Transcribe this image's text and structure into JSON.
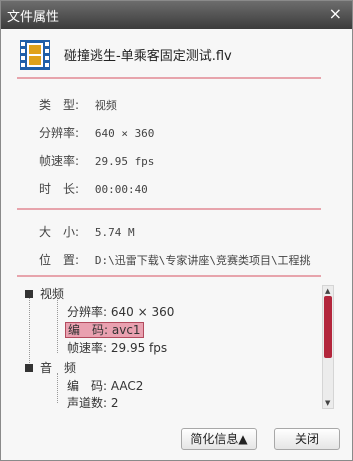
{
  "window": {
    "title": "文件属性",
    "close_glyph": "×"
  },
  "file": {
    "icon": "film-file-icon",
    "name": "碰撞逃生-单乘客固定测试.flv"
  },
  "info": [
    {
      "label": "类　型:",
      "value": "视频"
    },
    {
      "label": "分辨率:",
      "value": "640 × 360"
    },
    {
      "label": "帧速率:",
      "value": "29.95 fps"
    },
    {
      "label": "时　长:",
      "value": "00:00:40"
    }
  ],
  "file_info": [
    {
      "label": "大　小:",
      "value": "5.74 M"
    },
    {
      "label": "位　置:",
      "value": "D:\\迅雷下载\\专家讲座\\竞赛类项目\\工程挑"
    }
  ],
  "tree": {
    "video": {
      "label": "视频",
      "items": [
        "分辨率: 640 × 360",
        "编　码: avc1",
        "帧速率: 29.95 fps"
      ]
    },
    "audio": {
      "label": "音　频",
      "items": [
        "编　码: AAC2",
        "声道数: 2"
      ]
    }
  },
  "buttons": {
    "simplify": "简化信息▲",
    "close": "关闭"
  },
  "colors": {
    "accent": "#b3263c",
    "divider": "#e7a4ac",
    "highlight": "#e9a1b0"
  }
}
